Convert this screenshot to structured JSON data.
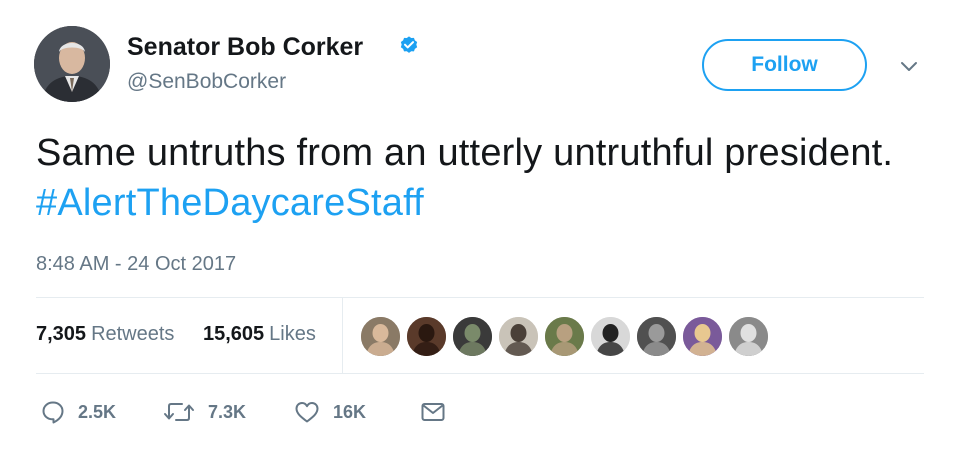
{
  "author": {
    "name": "Senator Bob Corker",
    "handle": "@SenBobCorker",
    "verified": true
  },
  "follow_label": "Follow",
  "tweet": {
    "text": "Same untruths from an utterly untruthful president. ",
    "hashtag": "#AlertTheDaycareStaff"
  },
  "timestamp": "8:48 AM - 24 Oct 2017",
  "stats": {
    "retweets_count": "7,305",
    "retweets_label": "Retweets",
    "likes_count": "15,605",
    "likes_label": "Likes"
  },
  "liker_avatars": [
    {
      "bg": "#8a7a66",
      "fg": "#d9b99b"
    },
    {
      "bg": "#5a3a2a",
      "fg": "#2a1810"
    },
    {
      "bg": "#3a3a3a",
      "fg": "#7a8a6a"
    },
    {
      "bg": "#c9c3b8",
      "fg": "#4a4038"
    },
    {
      "bg": "#6a7a4a",
      "fg": "#b8a080"
    },
    {
      "bg": "#d8d8d8",
      "fg": "#222222"
    },
    {
      "bg": "#505050",
      "fg": "#9a9a9a"
    },
    {
      "bg": "#7a5a9a",
      "fg": "#e8c890"
    },
    {
      "bg": "#8a8a8a",
      "fg": "#e0e0e0"
    }
  ],
  "actions": {
    "reply_count": "2.5K",
    "retweet_count": "7.3K",
    "like_count": "16K"
  },
  "colors": {
    "accent": "#1da1f2",
    "secondary_text": "#657786",
    "divider": "#e6ecf0"
  },
  "icons": {
    "verified": "verified-badge-icon",
    "caret": "chevron-down-icon",
    "reply": "speech-bubble-icon",
    "retweet": "retweet-arrows-icon",
    "like": "heart-icon",
    "dm": "envelope-icon"
  }
}
